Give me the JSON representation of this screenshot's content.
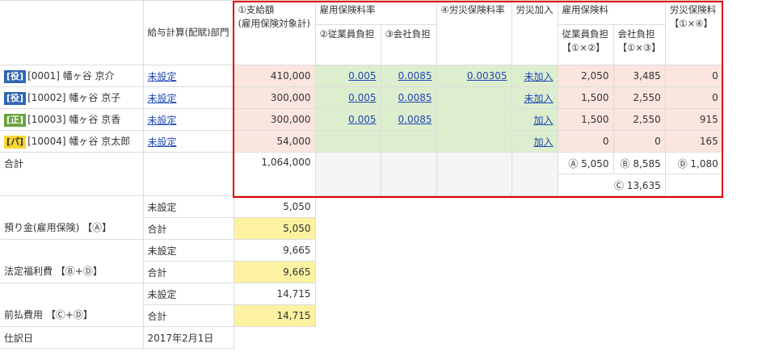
{
  "headers": {
    "dept": "給与計算(配賦)部門",
    "pay_line1": "①支給額",
    "pay_line2": "(雇用保険対象計)",
    "emp_rate": "雇用保険料率",
    "emp_rate_employee": "②従業員負担",
    "emp_rate_company": "③会社負担",
    "accident_rate": "④労災保険料率",
    "accident_join": "労災加入",
    "emp_ins": "雇用保険料",
    "emp_ins_employee_1": "従業員負担",
    "emp_ins_employee_2": "【①×②】",
    "emp_ins_company_1": "会社負担",
    "emp_ins_company_2": "【①×③】",
    "accident_ins_1": "労災保険料",
    "accident_ins_2": "【①×④】"
  },
  "employees": [
    {
      "badge": "[役]",
      "name": "[0001] 幡ヶ谷 京介",
      "dept": "未設定",
      "pay": "410,000",
      "rate_emp": "0.005",
      "rate_comp": "0.0085",
      "accident_rate": "0.00305",
      "join": "未加入",
      "ins_emp": "2,050",
      "ins_comp": "3,485",
      "accident": "0"
    },
    {
      "badge": "[役]",
      "name": "[10002] 幡ヶ谷 京子",
      "dept": "未設定",
      "pay": "300,000",
      "rate_emp": "0.005",
      "rate_comp": "0.0085",
      "accident_rate": "",
      "join": "未加入",
      "ins_emp": "1,500",
      "ins_comp": "2,550",
      "accident": "0"
    },
    {
      "badge": "[正]",
      "name": "[10003] 幡ヶ谷 京香",
      "dept": "未設定",
      "pay": "300,000",
      "rate_emp": "0.005",
      "rate_comp": "0.0085",
      "accident_rate": "",
      "join": "加入",
      "ins_emp": "1,500",
      "ins_comp": "2,550",
      "accident": "915"
    },
    {
      "badge": "[パ]",
      "name": "[10004] 幡ヶ谷 京太郎",
      "dept": "未設定",
      "pay": "54,000",
      "rate_emp": "",
      "rate_comp": "",
      "accident_rate": "",
      "join": "加入",
      "ins_emp": "0",
      "ins_comp": "0",
      "accident": "165"
    }
  ],
  "total": {
    "label": "合計",
    "pay": "1,064,000",
    "ins_emp": "Ⓐ 5,050",
    "ins_comp": "Ⓑ 8,585",
    "accident": "Ⓓ 1,080",
    "sum_c": "Ⓒ 13,635"
  },
  "summary": {
    "unset": "未設定",
    "total": "合計",
    "deposit_label": "預り金(雇用保険) 【Ⓐ】",
    "deposit_unset": "5,050",
    "deposit_total": "5,050",
    "welfare_label": "法定福利費 【Ⓑ+Ⓓ】",
    "welfare_unset": "9,665",
    "welfare_total": "9,665",
    "prepaid_label": "前払費用 【Ⓒ+Ⓓ】",
    "prepaid_unset": "14,715",
    "prepaid_total": "14,715",
    "journal_label": "仕訳日",
    "journal_date": "2017年2月1日"
  },
  "colors": {
    "pay_column": "#fbe6df",
    "rate_columns": "#ddeecf",
    "summary_total": "#fcf2a2",
    "highlight_border": "#e00000",
    "badge_officer": "#2f66b2",
    "badge_regular": "#6aa33c",
    "badge_part": "#f8d730"
  }
}
